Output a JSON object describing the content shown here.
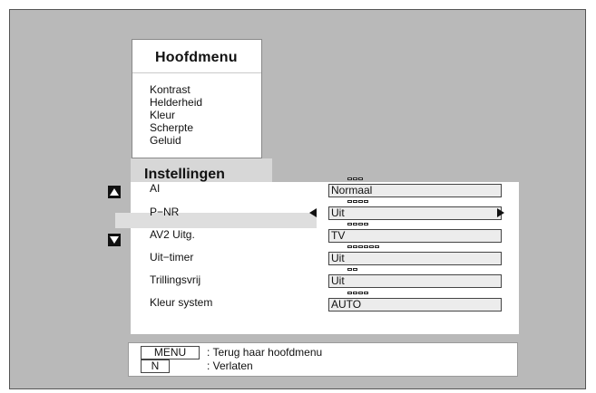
{
  "main_menu": {
    "title": "Hoofdmenu",
    "items": [
      "Kontrast",
      "Helderheid",
      "Kleur",
      "Scherpte",
      "Geluid"
    ]
  },
  "settings": {
    "title": "Instellingen",
    "selected_index": 1,
    "rows": [
      {
        "label": "AI",
        "value": "Normaal",
        "dots": 3
      },
      {
        "label": "P−NR",
        "value": "Uit",
        "dots": 4
      },
      {
        "label": "AV2 Uitg.",
        "value": "TV",
        "dots": 4
      },
      {
        "label": "Uit−timer",
        "value": "Uit",
        "dots": 6
      },
      {
        "label": "Trillingsvrij",
        "value": "Uit",
        "dots": 2
      },
      {
        "label": "Kleur system",
        "value": "AUTO",
        "dots": 4
      }
    ]
  },
  "footer": {
    "menu_key": "MENU",
    "menu_text": ": Terug haar hoofdmenu",
    "n_key": "N",
    "n_text": ": Verlaten"
  },
  "icons": {
    "scroll_up": "triangle-up-icon",
    "scroll_down": "triangle-down-icon",
    "value_left": "triangle-left-icon",
    "value_right": "triangle-right-icon"
  },
  "colors": {
    "screen_background": "#b9b9b9",
    "panel_background": "#ffffff",
    "selected_row": "#dedede",
    "field_background": "#ececec"
  }
}
